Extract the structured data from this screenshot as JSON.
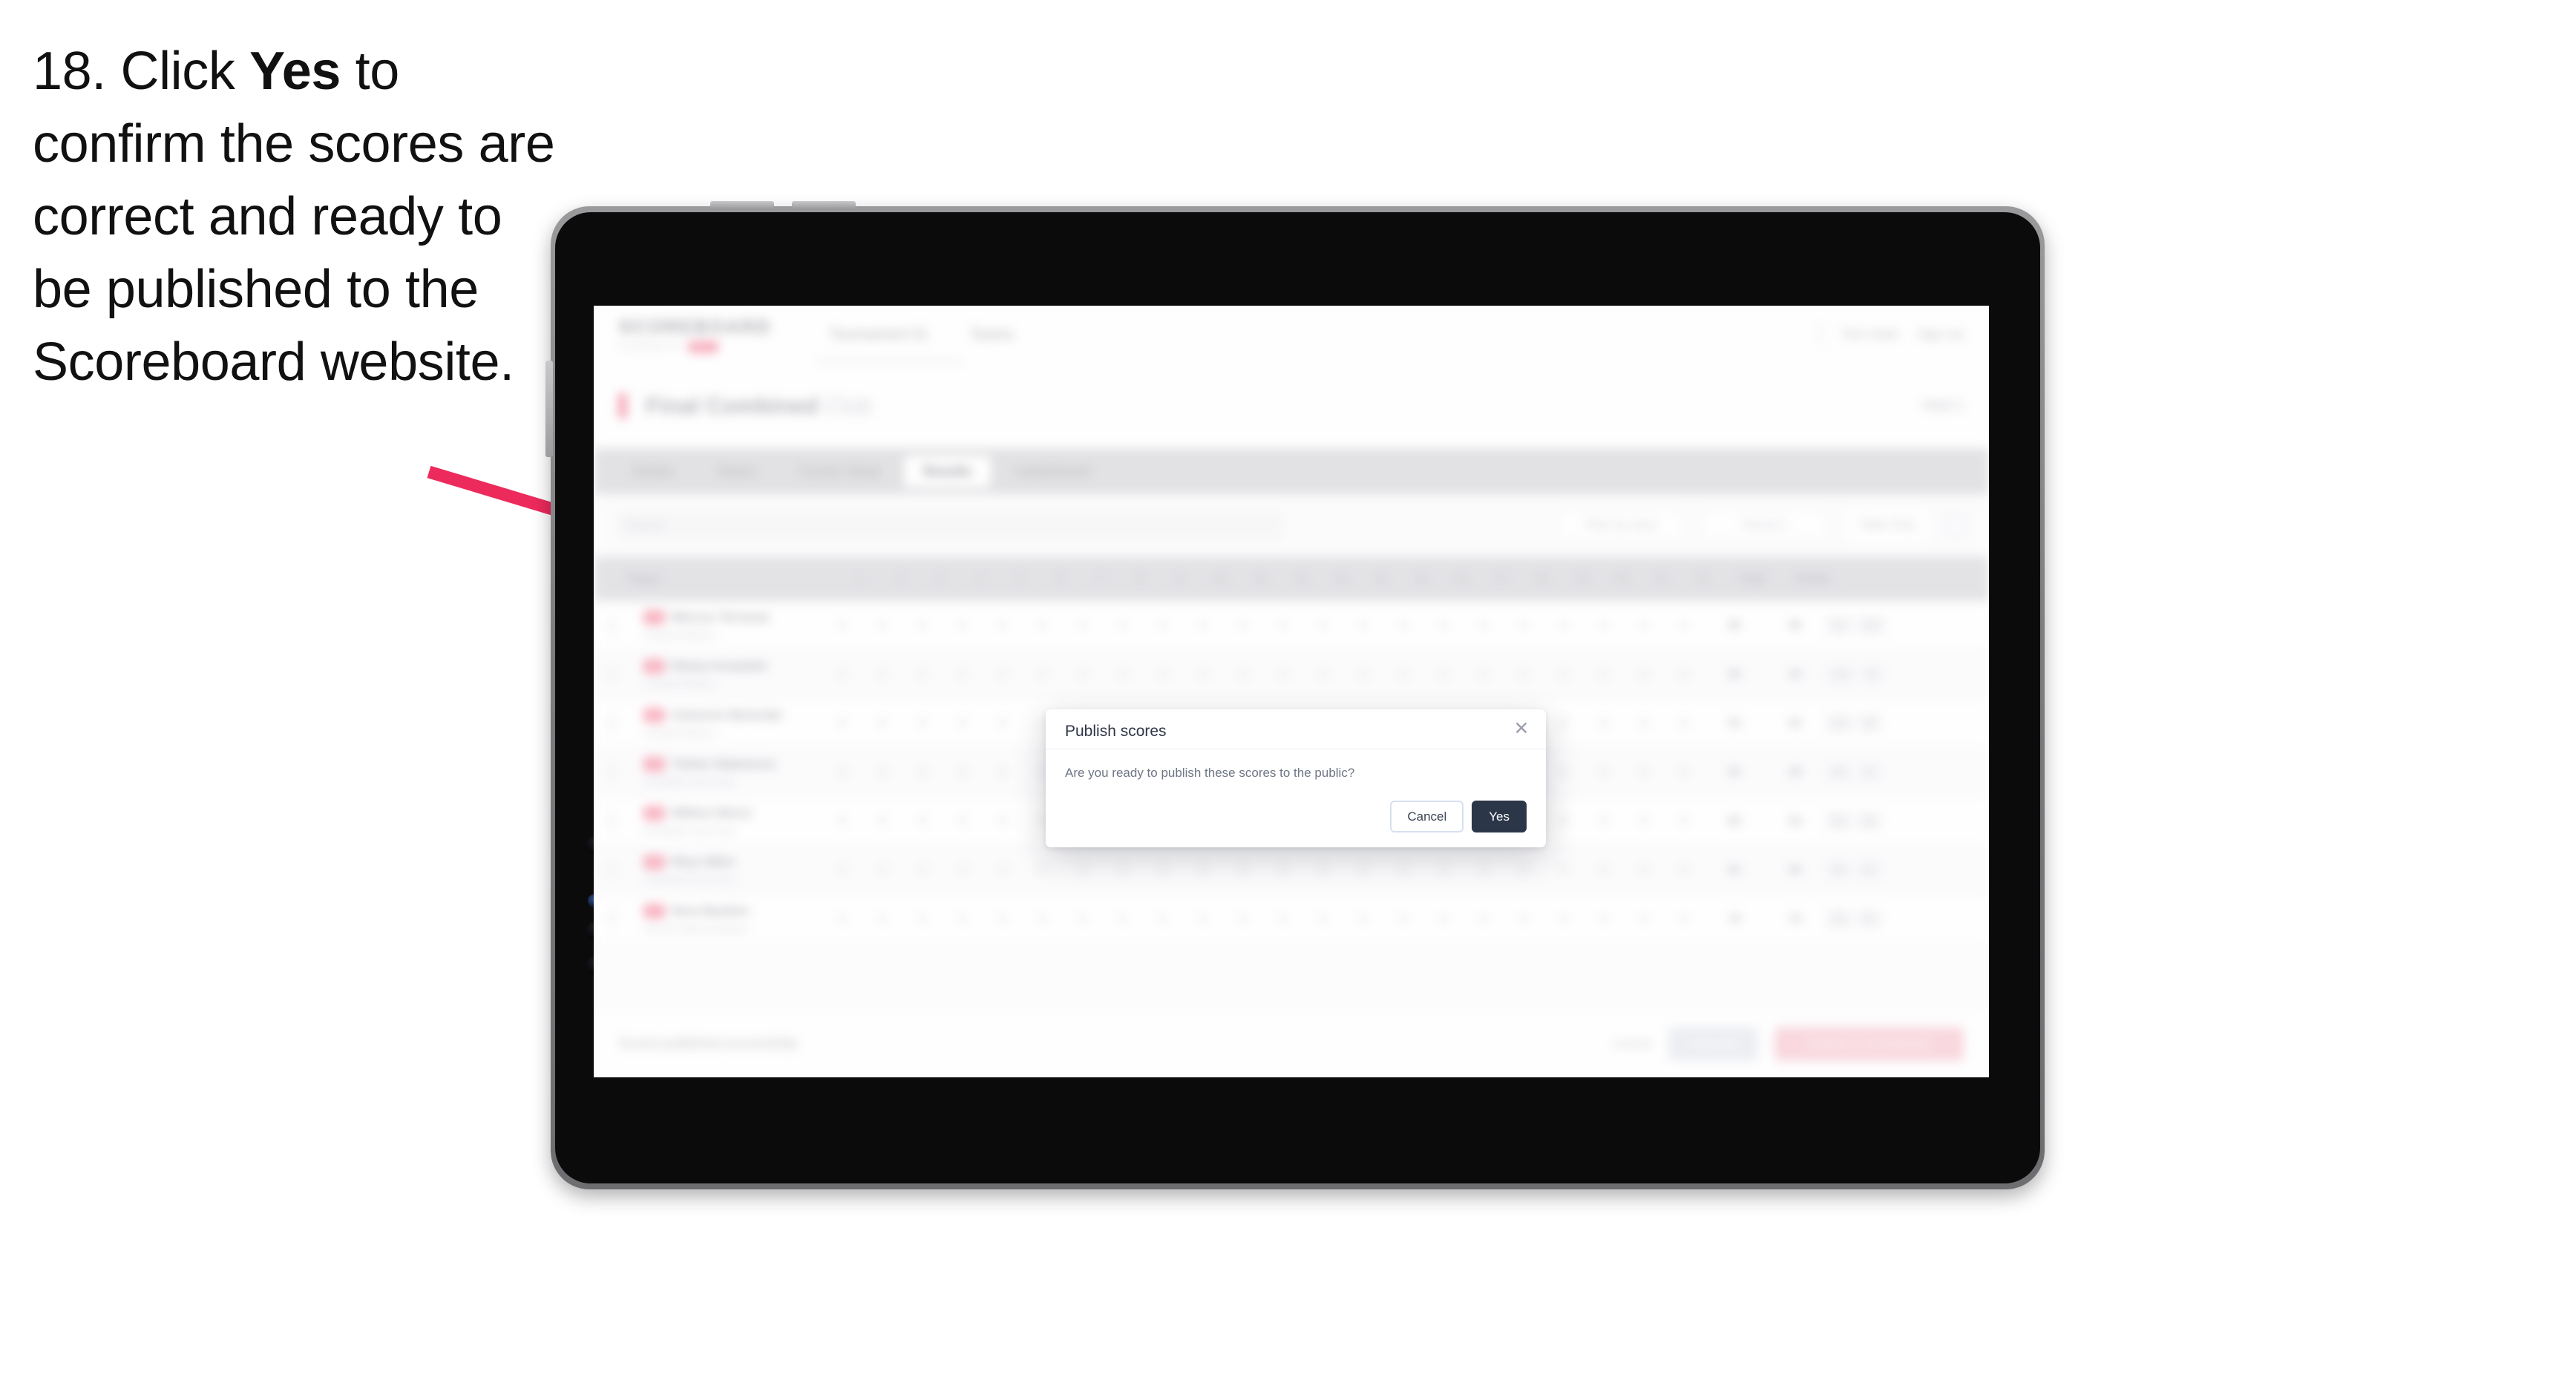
{
  "instruction": {
    "step_number": "18.",
    "before_bold": " Click ",
    "bold_word": "Yes",
    "after_bold": " to confirm the scores are correct and ready to be published to the Scoreboard website."
  },
  "annotation": {
    "arrow_color": "#EC2A5C",
    "points_to": "yes-button"
  },
  "modal": {
    "title": "Publish scores",
    "body_text": "Are you ready to publish these scores to the public?",
    "close_icon": "close-icon",
    "cancel_label": "Cancel",
    "yes_label": "Yes",
    "yes_bg": "#2B3648",
    "cancel_border": "#D7E0F0"
  },
  "app": {
    "brand": {
      "name": "SCOREBOARD",
      "sub": "POWERED BY",
      "pill": "BETA"
    },
    "nav": [
      "Tournament 01",
      "Teams"
    ],
    "header_links": [
      "Tom Clark",
      "Sign out"
    ],
    "page": {
      "back_icon": "back-bar-icon",
      "title": "Final Combined",
      "title_muted": "Club",
      "action": "Heat 1"
    },
    "tabs": [
      {
        "label": "Details",
        "active": false
      },
      {
        "label": "Teams",
        "active": false
      },
      {
        "label": "Course Setup",
        "active": false
      },
      {
        "label": "Results",
        "active": true
      },
      {
        "label": "Leaderboard",
        "active": false
      }
    ],
    "toolbar": {
      "search_placeholder": "Search",
      "filter_label": "Filter by class",
      "select_label": "Round 1",
      "view_label": "Table Only",
      "grid_icon": "grid-icon"
    },
    "table": {
      "columns": [
        "Player",
        "1",
        "2",
        "3",
        "4",
        "5",
        "6",
        "7",
        "8",
        "9",
        "10",
        "11",
        "12",
        "13",
        "14",
        "15",
        "16",
        "17",
        "18",
        "19",
        "20",
        "21",
        "22",
        "Total",
        "Points"
      ],
      "rows": [
        {
          "badge": "01",
          "name": "Marcus Terrazas",
          "sub": "Coastal Athletics",
          "scores": [
            "0",
            "0",
            "0",
            "0",
            "0",
            "0",
            "0",
            "0",
            "0",
            "0",
            "0",
            "0",
            "0",
            "0",
            "0",
            "0",
            "0",
            "0",
            "0",
            "0",
            "0",
            "0"
          ],
          "total": "98",
          "points": "96",
          "pills": [
            "1st",
            "100"
          ]
        },
        {
          "badge": "02",
          "name": "Eliana Kowalski",
          "sub": "Coastal Athletics",
          "scores": [
            "0",
            "0",
            "0",
            "0",
            "0",
            "0",
            "0",
            "0",
            "0",
            "0",
            "0",
            "0",
            "0",
            "0",
            "0",
            "0",
            "0",
            "0",
            "0",
            "0",
            "0",
            "0"
          ],
          "total": "96",
          "points": "94",
          "pills": [
            "2nd",
            "92"
          ]
        },
        {
          "badge": "03",
          "name": "Cameron Boisclair",
          "sub": "Coastal Athletics",
          "scores": [
            "0",
            "0",
            "0",
            "0",
            "0",
            "0",
            "0",
            "0",
            "0",
            "0",
            "0",
            "0",
            "0",
            "0",
            "0",
            "0",
            "0",
            "0",
            "0",
            "0",
            "0",
            "0"
          ],
          "total": "94",
          "points": "92",
          "pills": [
            "3rd",
            "84"
          ]
        },
        {
          "badge": "04",
          "name": "Tobias Nakamura",
          "sub": "Northfield Track Club",
          "scores": [
            "0",
            "0",
            "0",
            "0",
            "0",
            "0",
            "0",
            "0",
            "0",
            "0",
            "0",
            "0",
            "0",
            "0",
            "0",
            "0",
            "0",
            "0",
            "0",
            "0",
            "0",
            "0"
          ],
          "total": "90",
          "points": "88",
          "pills": [
            "4th",
            "76"
          ]
        },
        {
          "badge": "05",
          "name": "Willow Okoro",
          "sub": "Northfield Track Club",
          "scores": [
            "0",
            "0",
            "0",
            "0",
            "0",
            "0",
            "0",
            "0",
            "0",
            "0",
            "0",
            "0",
            "0",
            "0",
            "0",
            "0",
            "0",
            "0",
            "0",
            "0",
            "0",
            "0"
          ],
          "total": "86",
          "points": "84",
          "pills": [
            "5th",
            "68"
          ]
        },
        {
          "badge": "06",
          "name": "Rhys Mihn",
          "sub": "Northfield Track Club",
          "scores": [
            "0",
            "0",
            "0",
            "0",
            "0",
            "0",
            "0",
            "0",
            "0",
            "0",
            "0",
            "0",
            "0",
            "0",
            "0",
            "0",
            "0",
            "0",
            "0",
            "0",
            "0",
            "0"
          ],
          "total": "82",
          "points": "80",
          "pills": [
            "6th",
            "60"
          ]
        },
        {
          "badge": "07",
          "name": "Nora Bastien",
          "sub": "Summit Valley Academy",
          "scores": [
            "0",
            "0",
            "0",
            "0",
            "0",
            "0",
            "0",
            "0",
            "0",
            "0",
            "0",
            "0",
            "0",
            "0",
            "0",
            "0",
            "0",
            "0",
            "0",
            "0",
            "0",
            "0"
          ],
          "total": "78",
          "points": "76",
          "pills": [
            "7th",
            "52"
          ]
        }
      ]
    },
    "footer": {
      "note": "Scores published successfully",
      "link": "Cancel",
      "save_label": "Save all",
      "publish_label": "Publish to Scoreboard"
    }
  },
  "device": {
    "type": "tablet",
    "bezel_color": "#7D7D80",
    "body_color": "#0B0B0C"
  }
}
